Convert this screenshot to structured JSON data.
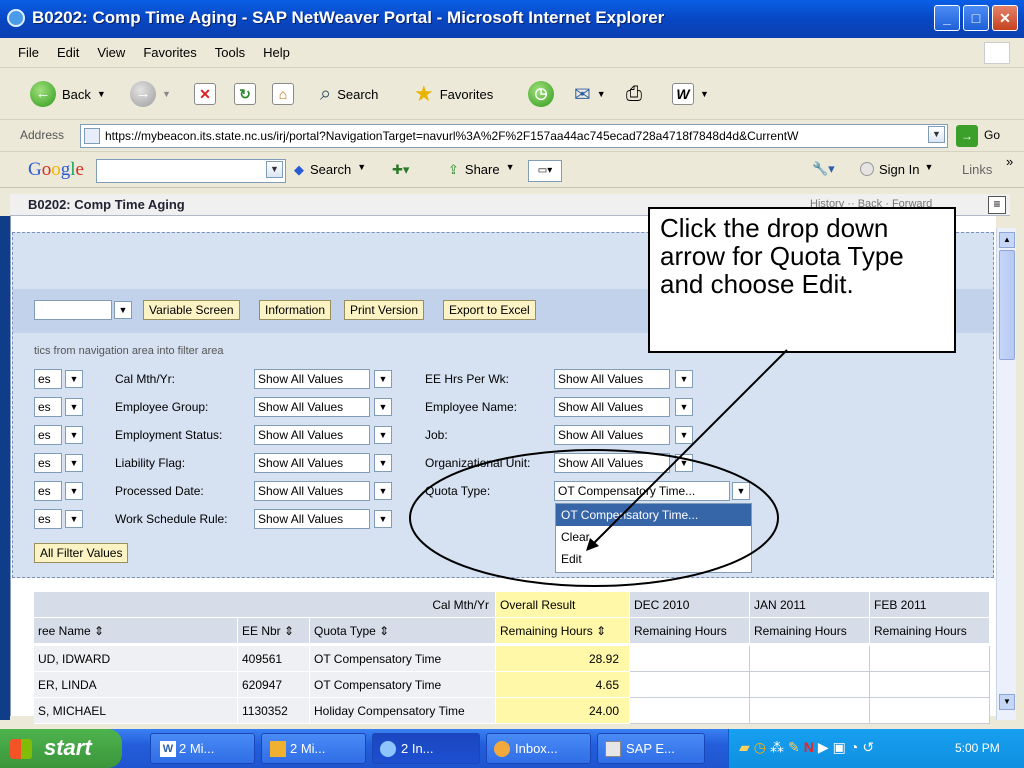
{
  "window": {
    "title": "B0202: Comp Time Aging - SAP NetWeaver Portal - Microsoft Internet Explorer"
  },
  "menu": [
    "File",
    "Edit",
    "View",
    "Favorites",
    "Tools",
    "Help"
  ],
  "toolbar": {
    "back": "Back",
    "search": "Search",
    "favorites": "Favorites"
  },
  "address": {
    "label": "Address",
    "url": "https://mybeacon.its.state.nc.us/irj/portal?NavigationTarget=navurl%3A%2F%2F157aa44ac745ecad728a4718f7848d4d&CurrentW",
    "go": "Go"
  },
  "googlebar": {
    "logo": "Google",
    "search": "Search",
    "share": "Share",
    "signin": "Sign In",
    "links": "Links"
  },
  "portal": {
    "title": "B0202: Comp Time Aging",
    "history": "History",
    "back": "Back",
    "forward": "Forward"
  },
  "actions": {
    "variable_screen": "Variable Screen",
    "information": "Information",
    "print_version": "Print Version",
    "export_excel": "Export to Excel"
  },
  "filter_hint": "tics from navigation area into filter area",
  "left_truncated": [
    "es",
    "es",
    "es",
    "es",
    "es",
    "es"
  ],
  "filters_col1": [
    {
      "label": "Cal Mth/Yr:",
      "value": "Show All Values"
    },
    {
      "label": "Employee Group:",
      "value": "Show All Values"
    },
    {
      "label": "Employment Status:",
      "value": "Show All Values"
    },
    {
      "label": "Liability Flag:",
      "value": "Show All Values"
    },
    {
      "label": "Processed Date:",
      "value": "Show All Values"
    },
    {
      "label": "Work Schedule Rule:",
      "value": "Show All Values"
    }
  ],
  "filters_col2": [
    {
      "label": "EE Hrs Per Wk:",
      "value": "Show All Values"
    },
    {
      "label": "Employee Name:",
      "value": "Show All Values"
    },
    {
      "label": "Job:",
      "value": "Show All Values"
    },
    {
      "label": "Organizational Unit:",
      "value": "Show All Values"
    },
    {
      "label": "Quota Type:",
      "value": "OT Compensatory Time..."
    }
  ],
  "dropdown_options": [
    "OT Compensatory Time...",
    "Clear",
    "Edit"
  ],
  "all_filter_values": "All Filter Values",
  "grid": {
    "cal_label": "Cal Mth/Yr",
    "periods": [
      "Overall Result",
      "DEC 2010",
      "JAN 2011",
      "FEB 2011"
    ],
    "headers": [
      "ree Name",
      "EE Nbr",
      "Quota Type",
      "Remaining Hours",
      "Remaining Hours",
      "Remaining Hours",
      "Remaining Hours"
    ],
    "rows": [
      {
        "name": "UD, IDWARD",
        "nbr": "409561",
        "type": "OT Compensatory Time",
        "hours": "28.92"
      },
      {
        "name": "ER, LINDA",
        "nbr": "620947",
        "type": "OT Compensatory Time",
        "hours": "4.65"
      },
      {
        "name": "S, MICHAEL",
        "nbr": "1130352",
        "type": "Holiday Compensatory Time",
        "hours": "24.00"
      }
    ]
  },
  "callout": "Click the drop down arrow for Quota Type and choose Edit.",
  "taskbar": {
    "start": "start",
    "tasks": [
      "2 Mi...",
      "2 Mi...",
      "2 In...",
      "Inbox...",
      "SAP E..."
    ],
    "clock": "5:00 PM"
  },
  "colors": {
    "title_blue": "#0a5fe6",
    "panel": "#d6e1f1",
    "button_yellow": "#fbf3c4",
    "highlight": "#3665a8",
    "result_yellow": "#fff8a8"
  }
}
